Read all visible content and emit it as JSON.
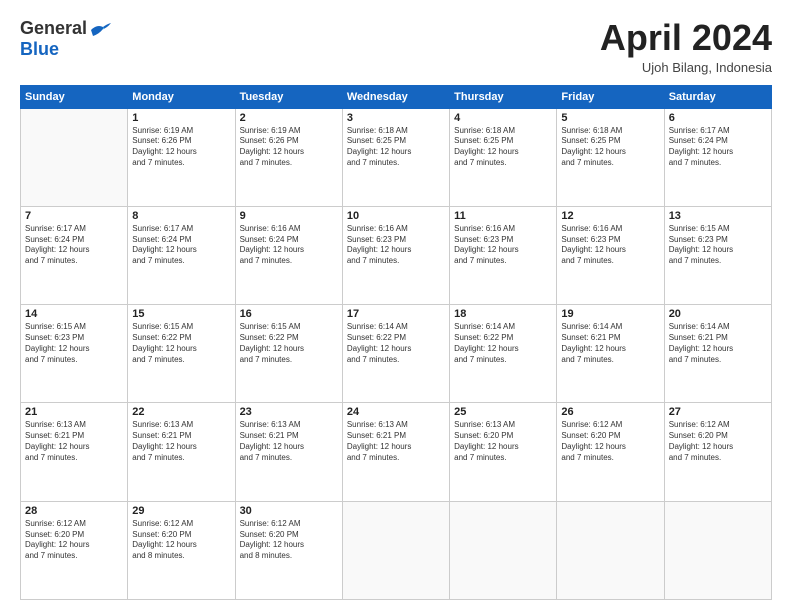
{
  "header": {
    "logo_general": "General",
    "logo_blue": "Blue",
    "month_year": "April 2024",
    "location": "Ujoh Bilang, Indonesia"
  },
  "days_of_week": [
    "Sunday",
    "Monday",
    "Tuesday",
    "Wednesday",
    "Thursday",
    "Friday",
    "Saturday"
  ],
  "weeks": [
    [
      {
        "day": "",
        "text": ""
      },
      {
        "day": "1",
        "text": "Sunrise: 6:19 AM\nSunset: 6:26 PM\nDaylight: 12 hours\nand 7 minutes."
      },
      {
        "day": "2",
        "text": "Sunrise: 6:19 AM\nSunset: 6:26 PM\nDaylight: 12 hours\nand 7 minutes."
      },
      {
        "day": "3",
        "text": "Sunrise: 6:18 AM\nSunset: 6:25 PM\nDaylight: 12 hours\nand 7 minutes."
      },
      {
        "day": "4",
        "text": "Sunrise: 6:18 AM\nSunset: 6:25 PM\nDaylight: 12 hours\nand 7 minutes."
      },
      {
        "day": "5",
        "text": "Sunrise: 6:18 AM\nSunset: 6:25 PM\nDaylight: 12 hours\nand 7 minutes."
      },
      {
        "day": "6",
        "text": "Sunrise: 6:17 AM\nSunset: 6:24 PM\nDaylight: 12 hours\nand 7 minutes."
      }
    ],
    [
      {
        "day": "7",
        "text": "Sunrise: 6:17 AM\nSunset: 6:24 PM\nDaylight: 12 hours\nand 7 minutes."
      },
      {
        "day": "8",
        "text": "Sunrise: 6:17 AM\nSunset: 6:24 PM\nDaylight: 12 hours\nand 7 minutes."
      },
      {
        "day": "9",
        "text": "Sunrise: 6:16 AM\nSunset: 6:24 PM\nDaylight: 12 hours\nand 7 minutes."
      },
      {
        "day": "10",
        "text": "Sunrise: 6:16 AM\nSunset: 6:23 PM\nDaylight: 12 hours\nand 7 minutes."
      },
      {
        "day": "11",
        "text": "Sunrise: 6:16 AM\nSunset: 6:23 PM\nDaylight: 12 hours\nand 7 minutes."
      },
      {
        "day": "12",
        "text": "Sunrise: 6:16 AM\nSunset: 6:23 PM\nDaylight: 12 hours\nand 7 minutes."
      },
      {
        "day": "13",
        "text": "Sunrise: 6:15 AM\nSunset: 6:23 PM\nDaylight: 12 hours\nand 7 minutes."
      }
    ],
    [
      {
        "day": "14",
        "text": "Sunrise: 6:15 AM\nSunset: 6:23 PM\nDaylight: 12 hours\nand 7 minutes."
      },
      {
        "day": "15",
        "text": "Sunrise: 6:15 AM\nSunset: 6:22 PM\nDaylight: 12 hours\nand 7 minutes."
      },
      {
        "day": "16",
        "text": "Sunrise: 6:15 AM\nSunset: 6:22 PM\nDaylight: 12 hours\nand 7 minutes."
      },
      {
        "day": "17",
        "text": "Sunrise: 6:14 AM\nSunset: 6:22 PM\nDaylight: 12 hours\nand 7 minutes."
      },
      {
        "day": "18",
        "text": "Sunrise: 6:14 AM\nSunset: 6:22 PM\nDaylight: 12 hours\nand 7 minutes."
      },
      {
        "day": "19",
        "text": "Sunrise: 6:14 AM\nSunset: 6:21 PM\nDaylight: 12 hours\nand 7 minutes."
      },
      {
        "day": "20",
        "text": "Sunrise: 6:14 AM\nSunset: 6:21 PM\nDaylight: 12 hours\nand 7 minutes."
      }
    ],
    [
      {
        "day": "21",
        "text": "Sunrise: 6:13 AM\nSunset: 6:21 PM\nDaylight: 12 hours\nand 7 minutes."
      },
      {
        "day": "22",
        "text": "Sunrise: 6:13 AM\nSunset: 6:21 PM\nDaylight: 12 hours\nand 7 minutes."
      },
      {
        "day": "23",
        "text": "Sunrise: 6:13 AM\nSunset: 6:21 PM\nDaylight: 12 hours\nand 7 minutes."
      },
      {
        "day": "24",
        "text": "Sunrise: 6:13 AM\nSunset: 6:21 PM\nDaylight: 12 hours\nand 7 minutes."
      },
      {
        "day": "25",
        "text": "Sunrise: 6:13 AM\nSunset: 6:20 PM\nDaylight: 12 hours\nand 7 minutes."
      },
      {
        "day": "26",
        "text": "Sunrise: 6:12 AM\nSunset: 6:20 PM\nDaylight: 12 hours\nand 7 minutes."
      },
      {
        "day": "27",
        "text": "Sunrise: 6:12 AM\nSunset: 6:20 PM\nDaylight: 12 hours\nand 7 minutes."
      }
    ],
    [
      {
        "day": "28",
        "text": "Sunrise: 6:12 AM\nSunset: 6:20 PM\nDaylight: 12 hours\nand 7 minutes."
      },
      {
        "day": "29",
        "text": "Sunrise: 6:12 AM\nSunset: 6:20 PM\nDaylight: 12 hours\nand 8 minutes."
      },
      {
        "day": "30",
        "text": "Sunrise: 6:12 AM\nSunset: 6:20 PM\nDaylight: 12 hours\nand 8 minutes."
      },
      {
        "day": "",
        "text": ""
      },
      {
        "day": "",
        "text": ""
      },
      {
        "day": "",
        "text": ""
      },
      {
        "day": "",
        "text": ""
      }
    ]
  ]
}
